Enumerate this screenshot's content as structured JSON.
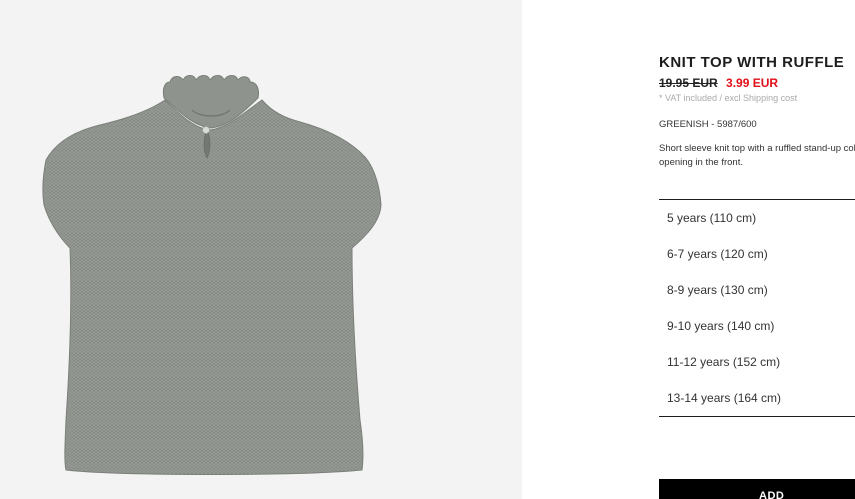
{
  "product": {
    "name": "KNIT TOP WITH RUFFLE",
    "old_price": "19.95 EUR",
    "new_price": "3.99 EUR",
    "vat_note": "* VAT included / ",
    "shipping_link": "excl Shipping cost",
    "color_ref": "GREENISH - 5987/600",
    "description": "Short sleeve knit top with a ruffled stand-up collar and buttoned teardrop opening in the front."
  },
  "sizes": [
    "5 years (110 cm)",
    "6-7 years (120 cm)",
    "8-9 years (130 cm)",
    "9-10 years (140 cm)",
    "11-12 years (152 cm)",
    "13-14 years (164 cm)"
  ],
  "add_button_label": "ADD",
  "colors": {
    "sale_price": "#e10f19",
    "garment": "#8a8f88",
    "image_background": "#f3f3f3",
    "button_background": "#000000"
  }
}
